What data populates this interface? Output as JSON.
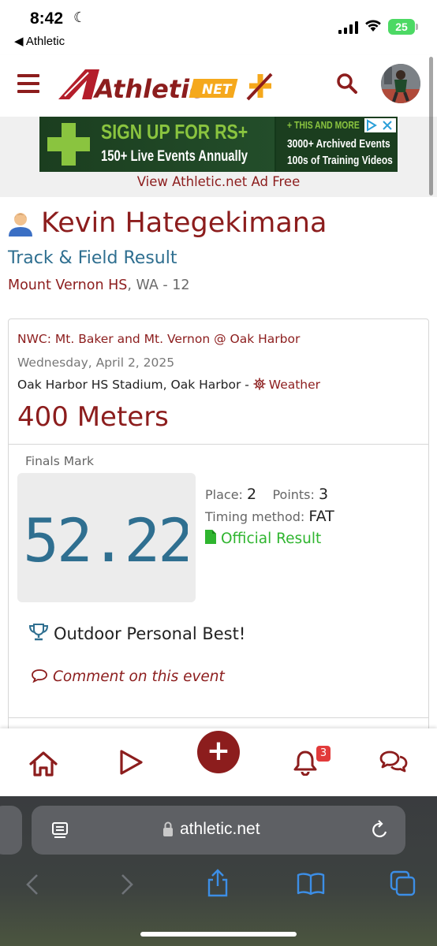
{
  "status_bar": {
    "time": "8:42",
    "back_app": "◀ Athletic",
    "battery": "25"
  },
  "header": {
    "logo_main": "Athletic",
    "logo_net": "NET"
  },
  "ad": {
    "headline": "SIGN UP FOR RS+",
    "subline": "150+ Live Events Annually",
    "right_top": "+ THIS AND MORE",
    "right_line1": "3000+ Archived Events",
    "right_line2": "100s of Training Videos",
    "ad_free_link": "View Athletic.net Ad Free"
  },
  "athlete": {
    "name": "Kevin Hategekimana",
    "result_type": "Track & Field Result",
    "school": "Mount Vernon HS",
    "school_rest": ", WA - 12"
  },
  "result": {
    "meet": "NWC: Mt. Baker and Mt. Vernon @ Oak Harbor",
    "date": "Wednesday, April 2, 2025",
    "venue": "Oak Harbor HS Stadium, Oak Harbor - ",
    "weather_label": "Weather",
    "event": "400 Meters",
    "finals_label": "Finals Mark",
    "mark": "52.22",
    "place_label": "Place: ",
    "place": "2",
    "points_label": "Points: ",
    "points": "3",
    "timing_label": "Timing method: ",
    "timing": "FAT",
    "official": "Official Result",
    "pb": "Outdoor Personal Best!",
    "comment": "Comment on this event"
  },
  "bottom_nav": {
    "notifications_count": "3"
  },
  "browser": {
    "url": "athletic.net"
  },
  "colors": {
    "brand": "#8c1d1d",
    "link_blue": "#2f6f90",
    "green": "#2fb52f",
    "ad_green": "#8ac43f"
  }
}
